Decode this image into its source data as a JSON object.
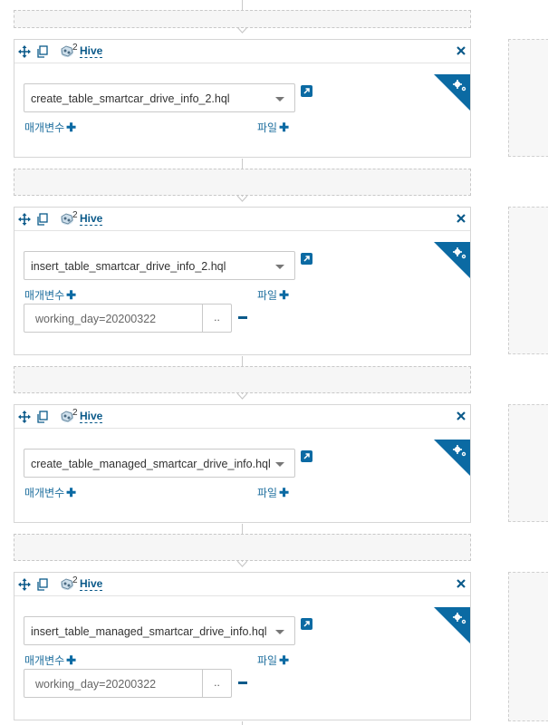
{
  "accent": "#0b6aa3",
  "icons": {
    "move": "move-icon",
    "copy": "copy-icon",
    "hive": "hive-icon",
    "close": "close-icon",
    "settings": "gear-icon",
    "external": "external-link-icon"
  },
  "actions": [
    {
      "type_label": "Hive",
      "type_sup": "2",
      "script": "create_table_smartcar_drive_info_2.hql",
      "params_label": "매개변수",
      "files_label": "파일",
      "params": []
    },
    {
      "type_label": "Hive",
      "type_sup": "2",
      "script": "insert_table_smartcar_drive_info_2.hql",
      "params_label": "매개변수",
      "files_label": "파일",
      "params": [
        {
          "value": "working_day=20200322",
          "button": ".."
        }
      ]
    },
    {
      "type_label": "Hive",
      "type_sup": "2",
      "script": "create_table_managed_smartcar_drive_info.hql",
      "params_label": "매개변수",
      "files_label": "파일",
      "params": []
    },
    {
      "type_label": "Hive",
      "type_sup": "2",
      "script": "insert_table_managed_smartcar_drive_info.hql",
      "params_label": "매개변수",
      "files_label": "파일",
      "params": [
        {
          "value": "working_day=20200322",
          "button": ".."
        }
      ]
    }
  ]
}
